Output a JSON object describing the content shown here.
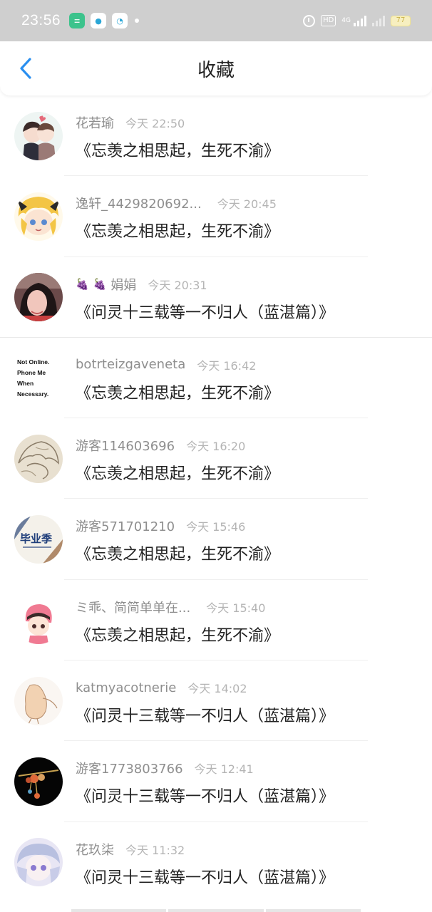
{
  "status_bar": {
    "time": "23:56",
    "hd": "HD",
    "network": "4G",
    "battery": "77",
    "apps": [
      "app-1",
      "app-2",
      "app-3"
    ]
  },
  "header": {
    "title": "收藏",
    "back_icon": "chevron-left-icon",
    "accent": "#2a8ff0"
  },
  "items": [
    {
      "name": "花若瑜",
      "time": "今天 22:50",
      "title": "《忘羡之相思起，生死不渝》"
    },
    {
      "name": "逸轩_4429820692...",
      "time": "今天 20:45",
      "title": "《忘羡之相思起，生死不渝》"
    },
    {
      "name": "娟娟",
      "time": "今天 20:31",
      "title": "《问灵十三载等一不归人（蓝湛篇）》"
    },
    {
      "name": "botrteizgaveneta",
      "time": "今天 16:42",
      "title": "《忘羡之相思起，生死不渝》",
      "avatar_text": [
        "Not Online.",
        "Phone Me",
        "When",
        "Necessary."
      ]
    },
    {
      "name": "游客114603696",
      "time": "今天 16:20",
      "title": "《忘羡之相思起，生死不渝》"
    },
    {
      "name": "游客571701210",
      "time": "今天 15:46",
      "title": "《忘羡之相思起，生死不渝》",
      "avatar_text": [
        "毕业季"
      ]
    },
    {
      "name": "ミ乖、简简单单在...",
      "time": "今天 15:40",
      "title": "《忘羡之相思起，生死不渝》"
    },
    {
      "name": "katmyacotnerie",
      "time": "今天 14:02",
      "title": "《问灵十三载等一不归人（蓝湛篇）》"
    },
    {
      "name": "游客1773803766",
      "time": "今天 12:41",
      "title": "《问灵十三载等一不归人（蓝湛篇）》"
    },
    {
      "name": "花玖柒",
      "time": "今天 11:32",
      "title": "《问灵十三载等一不归人（蓝湛篇）》"
    }
  ]
}
